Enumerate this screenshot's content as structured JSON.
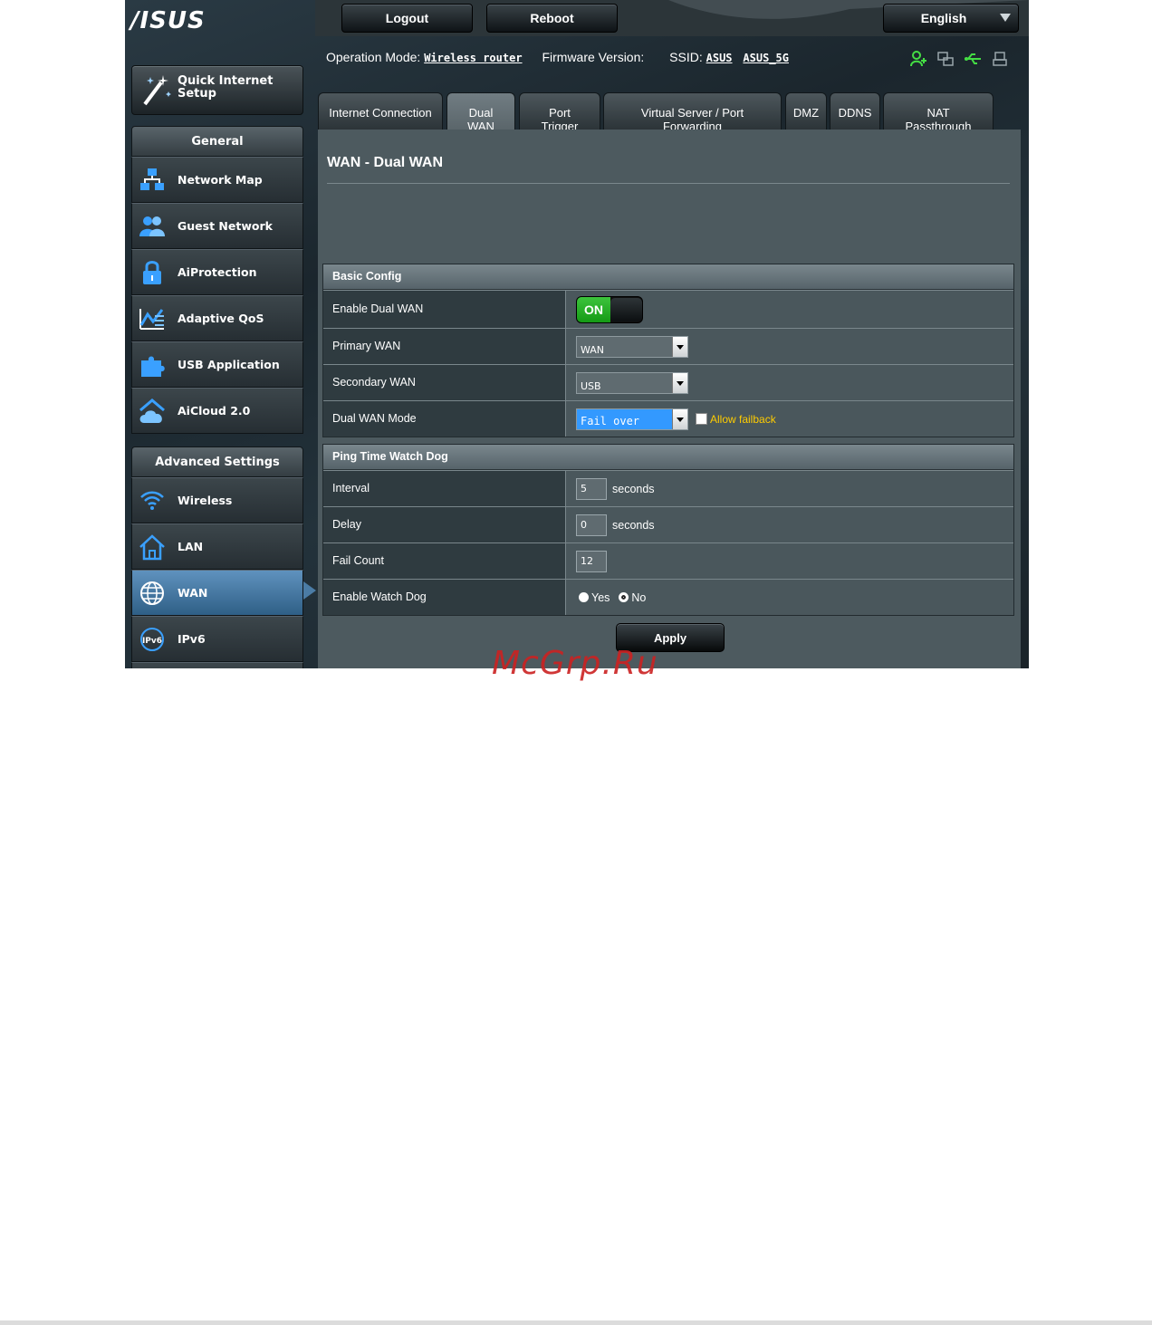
{
  "header": {
    "logo": "/ISUS",
    "logout_label": "Logout",
    "reboot_label": "Reboot",
    "language": "English"
  },
  "infobar": {
    "operation_mode_label": "Operation Mode:",
    "operation_mode_value": "Wireless router",
    "firmware_label": "Firmware Version:",
    "ssid_label": "SSID:",
    "ssid_1": "ASUS",
    "ssid_2": "ASUS_5G",
    "status_icons": [
      "clients-icon",
      "network-icon",
      "usb-icon",
      "printer-icon"
    ]
  },
  "sidebar": {
    "quick_setup": "Quick Internet Setup",
    "general_header": "General",
    "general_items": [
      {
        "label": "Network Map",
        "icon": "network-map-icon"
      },
      {
        "label": "Guest Network",
        "icon": "guest-network-icon"
      },
      {
        "label": "AiProtection",
        "icon": "lock-icon"
      },
      {
        "label": "Adaptive QoS",
        "icon": "qos-icon"
      },
      {
        "label": "USB Application",
        "icon": "puzzle-icon"
      },
      {
        "label": "AiCloud 2.0",
        "icon": "cloud-icon"
      }
    ],
    "advanced_header": "Advanced Settings",
    "advanced_items": [
      {
        "label": "Wireless",
        "icon": "wifi-icon"
      },
      {
        "label": "LAN",
        "icon": "home-icon"
      },
      {
        "label": "WAN",
        "icon": "globe-icon",
        "active": true
      },
      {
        "label": "IPv6",
        "icon": "ipv6-icon"
      }
    ]
  },
  "tabs": [
    {
      "label": "Internet Connection"
    },
    {
      "label": "Dual WAN",
      "active": true
    },
    {
      "label": "Port Trigger"
    },
    {
      "label": "Virtual Server / Port Forwarding"
    },
    {
      "label": "DMZ"
    },
    {
      "label": "DDNS"
    },
    {
      "label": "NAT Passthrough"
    }
  ],
  "page": {
    "title": "WAN - Dual WAN",
    "basic_config": {
      "header": "Basic Config",
      "enable_dual_wan_label": "Enable Dual WAN",
      "enable_dual_wan_value": "ON",
      "primary_wan_label": "Primary WAN",
      "primary_wan_value": "WAN",
      "secondary_wan_label": "Secondary WAN",
      "secondary_wan_value": "USB",
      "mode_label": "Dual WAN Mode",
      "mode_value": "Fail over",
      "allow_failback_label": "Allow failback"
    },
    "watchdog": {
      "header": "Ping Time Watch Dog",
      "interval_label": "Interval",
      "interval_value": "5",
      "interval_unit": "seconds",
      "delay_label": "Delay",
      "delay_value": "0",
      "delay_unit": "seconds",
      "fail_count_label": "Fail Count",
      "fail_count_value": "12",
      "enable_label": "Enable Watch Dog",
      "yes_label": "Yes",
      "no_label": "No"
    },
    "apply_label": "Apply"
  },
  "watermark": "McGrp.Ru",
  "colors": {
    "accent_green": "#22aa22",
    "failback_yellow": "#ffcc00",
    "active_blue": "#4b7ca5"
  }
}
